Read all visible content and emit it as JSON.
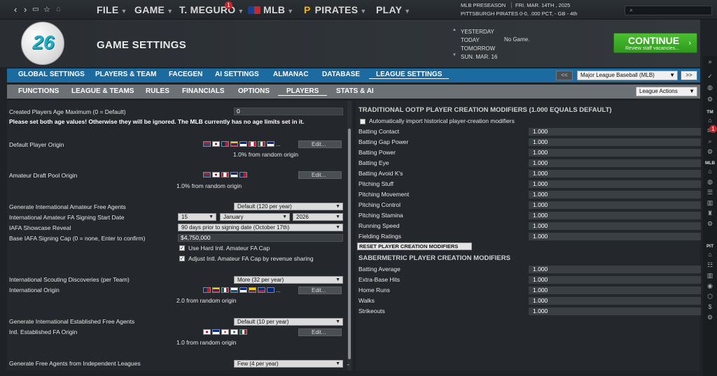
{
  "topbar": {
    "nav_icons": [
      "back-arrow-icon",
      "forward-arrow-icon",
      "window-icon",
      "star-icon",
      "home-icon"
    ],
    "menus": [
      {
        "label": "FILE"
      },
      {
        "label": "GAME"
      },
      {
        "label": "T. MEGURO",
        "badge": "1"
      },
      {
        "label": "MLB"
      },
      {
        "label": "PIRATES"
      },
      {
        "label": "PLAY"
      }
    ],
    "season_line1": "MLB PRESEASON",
    "date": "FRI. MAR. 14TH , 2025",
    "team_line": "PITTSBURGH PIRATES",
    "record": "0-0, .000 PCT, - GB - 4th",
    "search_placeholder": ""
  },
  "header": {
    "logo_number": "26",
    "title": "GAME SETTINGS",
    "days": [
      "YESTERDAY",
      "TODAY",
      "TOMORROW",
      "SUN. MAR. 16"
    ],
    "today_status": "No Game.",
    "continue_label": "CONTINUE",
    "continue_sub": "Review staff vacancies..."
  },
  "tabs1": [
    "GLOBAL SETTINGS",
    "PLAYERS & TEAM",
    "FACEGEN",
    "AI SETTINGS",
    "ALMANAC",
    "DATABASE",
    "LEAGUE SETTINGS"
  ],
  "tabs1_active": "LEAGUE SETTINGS",
  "league_nav": {
    "prev": "<<",
    "league": "Major League Baseball (MLB)",
    "next": ">>"
  },
  "tabs2": [
    "FUNCTIONS",
    "LEAGUE & TEAMS",
    "RULES",
    "FINANCIALS",
    "OPTIONS",
    "PLAYERS",
    "STATS & AI"
  ],
  "tabs2_active": "PLAYERS",
  "league_actions": "League Actions",
  "left": {
    "age_max_label": "Created Players Age Maximum (0 = Default)",
    "age_max_value": "0",
    "age_warning": "Please set both age values! Otherwise they will be ignored. The MLB currently has no age limits set in it.",
    "default_origin_label": "Default Player Origin",
    "default_origin_note": "1.0% from random origin",
    "draft_origin_label": "Amateur Draft Pool Origin",
    "draft_origin_note": "1.0% from random origin",
    "gen_intl_label": "Generate International Amateur Free Agents",
    "gen_intl_value": "Default (120 per year)",
    "signing_start_label": "International Amateur FA Signing Start Date",
    "signing_day": "15",
    "signing_month": "January",
    "signing_year": "2026",
    "showcase_label": "IAFA Showcase Reveal",
    "showcase_value": "90 days prior to signing date (October 17th)",
    "cap_label": "Base IAFA Signing Cap (0 = none, Enter to confirm)",
    "cap_value": "$4,750,000",
    "hard_cap_label": "Use Hard Intl. Amateur FA Cap",
    "adjust_cap_label": "Adjust Intl. Amateur FA Cap by revenue sharing",
    "scouting_label": "International Scouting Discoveries (per Team)",
    "scouting_value": "More (32 per year)",
    "intl_origin_label": "International Origin",
    "intl_origin_note": "2.0 from random origin",
    "gen_est_label": "Generate International Established Free Agents",
    "gen_est_value": "Default (10 per year)",
    "est_origin_label": "Intl. Established FA Origin",
    "est_origin_note": "1.0 from random origin",
    "indep_label": "Generate Free Agents from Independent Leagues",
    "indep_value": "Few (4 per year)",
    "edit_label": "Edit...",
    "ellipsis": "..."
  },
  "right": {
    "trad_header": "TRADITIONAL OOTP PLAYER CREATION MODIFIERS (1.000 EQUALS DEFAULT)",
    "auto_import_label": "Automatically import historical player-creation modifiers",
    "trad_rows": [
      {
        "label": "Batting Contact",
        "value": "1.000"
      },
      {
        "label": "Batting Gap Power",
        "value": "1.000"
      },
      {
        "label": "Batting Power",
        "value": "1.000"
      },
      {
        "label": "Batting Eye",
        "value": "1.000"
      },
      {
        "label": "Batting Avoid K's",
        "value": "1.000"
      },
      {
        "label": "Pitching Stuff",
        "value": "1.000"
      },
      {
        "label": "Pitching Movement",
        "value": "1.000"
      },
      {
        "label": "Pitching Control",
        "value": "1.000"
      },
      {
        "label": "Pitching Stamina",
        "value": "1.000"
      },
      {
        "label": "Running Speed",
        "value": "1.000"
      },
      {
        "label": "Fielding Ratings",
        "value": "1.000"
      }
    ],
    "reset_label": "RESET PLAYER CREATION MODIFIERS",
    "saber_header": "SABERMETRIC PLAYER CREATION MODIFIERS",
    "saber_rows": [
      {
        "label": "Batting Average",
        "value": "1.000"
      },
      {
        "label": "Extra-Base Hits",
        "value": "1.000"
      },
      {
        "label": "Home Runs",
        "value": "1.000"
      },
      {
        "label": "Walks",
        "value": "1.000"
      },
      {
        "label": "Strikeouts",
        "value": "1.000"
      }
    ]
  },
  "sidebar": {
    "tm": "TM",
    "tm_badge": "1",
    "mlb": "MLB",
    "pit": "PIT"
  }
}
